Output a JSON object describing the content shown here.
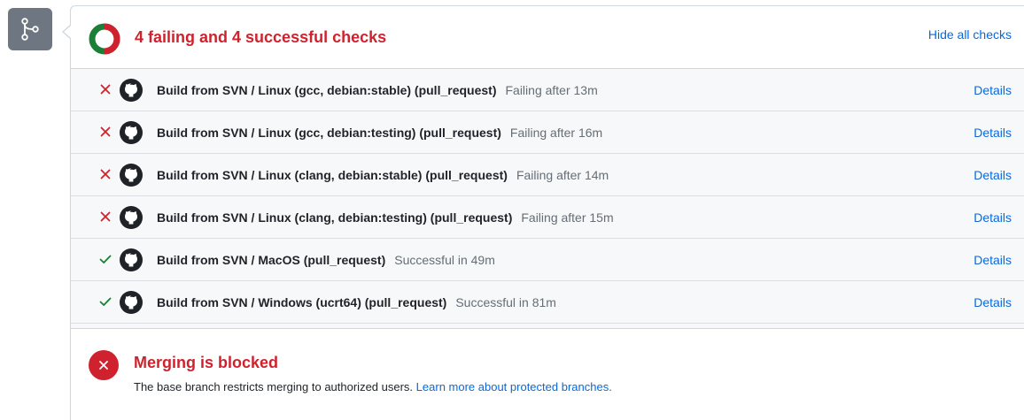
{
  "colors": {
    "failure": "#cf222e",
    "success": "#1a7f37",
    "link": "#0969da",
    "muted": "#656d76",
    "badge": "#6e7781"
  },
  "branch_icon": "git-branch-icon",
  "checks_summary": {
    "title": "4 failing and 4 successful checks",
    "hide_label": "Hide all checks",
    "failing": 4,
    "successful": 4
  },
  "checks": [
    {
      "state": "failure",
      "name": "Build from SVN / Linux (gcc, debian:stable) (pull_request)",
      "status": "Failing after 13m",
      "details_label": "Details"
    },
    {
      "state": "failure",
      "name": "Build from SVN / Linux (gcc, debian:testing) (pull_request)",
      "status": "Failing after 16m",
      "details_label": "Details"
    },
    {
      "state": "failure",
      "name": "Build from SVN / Linux (clang, debian:stable) (pull_request)",
      "status": "Failing after 14m",
      "details_label": "Details"
    },
    {
      "state": "failure",
      "name": "Build from SVN / Linux (clang, debian:testing) (pull_request)",
      "status": "Failing after 15m",
      "details_label": "Details"
    },
    {
      "state": "success",
      "name": "Build from SVN / MacOS (pull_request)",
      "status": "Successful in 49m",
      "details_label": "Details"
    },
    {
      "state": "success",
      "name": "Build from SVN / Windows (ucrt64) (pull_request)",
      "status": "Successful in 81m",
      "details_label": "Details"
    }
  ],
  "merge": {
    "title": "Merging is blocked",
    "description": "The base branch restricts merging to authorized users.",
    "link_label": "Learn more about protected branches."
  }
}
